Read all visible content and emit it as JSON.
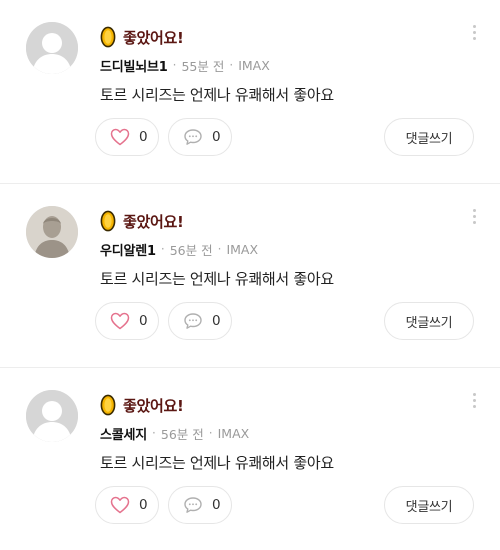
{
  "comments": [
    {
      "rating_label": "좋았어요!",
      "username": "드디빌뇌브1",
      "time": "55분 전",
      "screen": "IMAX",
      "body": "토르 시리즈는 언제나 유쾌해서 좋아요",
      "likes": "0",
      "replies": "0",
      "write_reply_label": "댓글쓰기",
      "avatar": "default-avatar"
    },
    {
      "rating_label": "좋았어요!",
      "username": "우디알렌1",
      "time": "56분 전",
      "screen": "IMAX",
      "body": "토르 시리즈는 언제나 유쾌해서 좋아요",
      "likes": "0",
      "replies": "0",
      "write_reply_label": "댓글쓰기",
      "avatar": "profile-photo"
    },
    {
      "rating_label": "좋았어요!",
      "username": "스콜세지",
      "time": "56분 전",
      "screen": "IMAX",
      "body": "토르 시리즈는 언제나 유쾌해서 좋아요",
      "likes": "0",
      "replies": "0",
      "write_reply_label": "댓글쓰기",
      "avatar": "default-avatar"
    }
  ],
  "colors": {
    "rating_text": "#5b1713",
    "coin_fill": "#f5b400",
    "coin_stroke": "#3a2a00",
    "like_heart": "#e5738e",
    "muted": "#9a9a9a"
  }
}
